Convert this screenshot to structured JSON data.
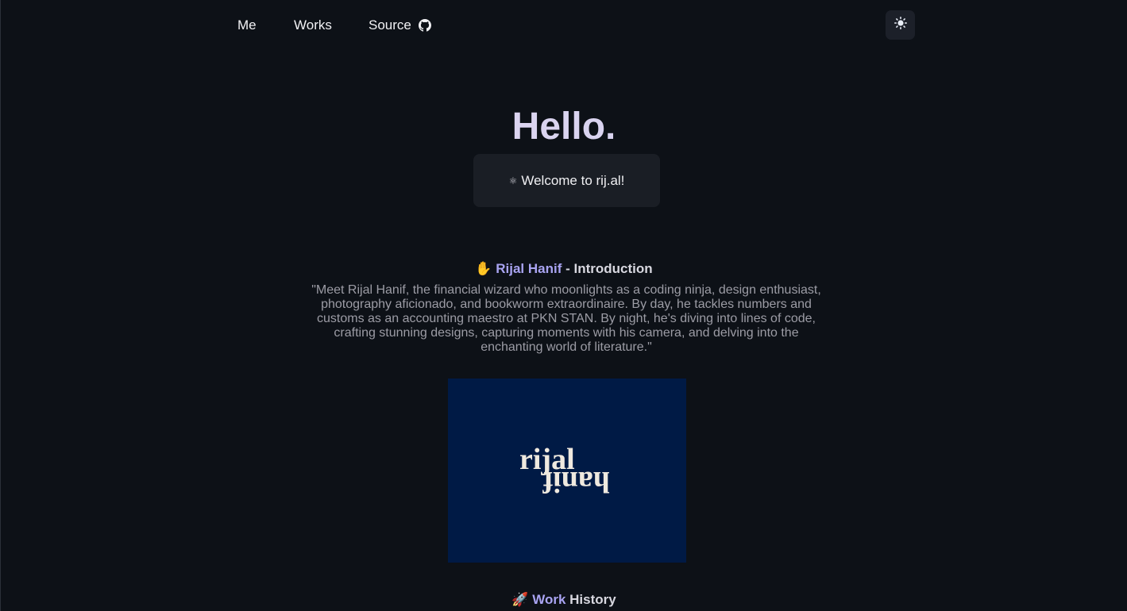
{
  "nav": {
    "links": [
      {
        "label": "Me"
      },
      {
        "label": "Works"
      },
      {
        "label": "Source"
      }
    ],
    "source_icon": "github-icon",
    "theme_toggle_icon": "sun-icon"
  },
  "hero": {
    "title": "Hello.",
    "welcome_icon": "⚛",
    "welcome_text": "Welcome to rij.al!"
  },
  "intro": {
    "emoji": "✋",
    "name": "Rijal Hanif",
    "suffix": " - Introduction",
    "quote": "\"Meet Rijal Hanif, the financial wizard who moonlights as a coding ninja, design enthusiast, photography aficionado, and bookworm extraordinaire. By day, he tackles numbers and customs as an accounting maestro at PKN STAN. By night, he's diving into lines of code, crafting stunning designs, capturing moments with his camera, and delving into the enchanting world of literature.\"",
    "logo": {
      "line1": "rijal",
      "line2": "hanif",
      "background": "#001a45"
    }
  },
  "work": {
    "emoji": "🚀",
    "accent_word": "Work",
    "rest": " History"
  },
  "colors": {
    "background": "#0d1117",
    "accent": "#a9a4f2",
    "card": "#1a1e25"
  }
}
